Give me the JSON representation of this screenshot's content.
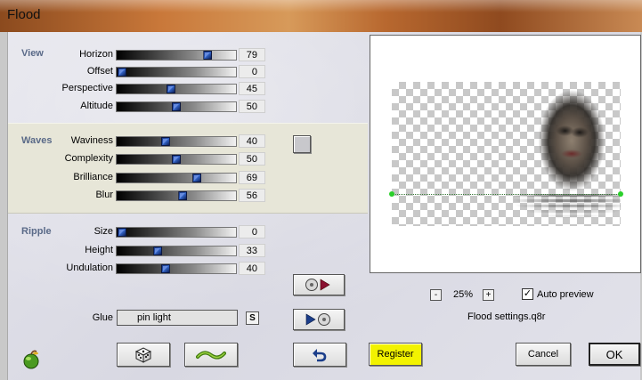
{
  "window": {
    "title": "Flood"
  },
  "groups": {
    "view": "View",
    "waves": "Waves",
    "ripple": "Ripple"
  },
  "sliders": [
    {
      "label": "Horizon",
      "value": "79",
      "level": 0.79
    },
    {
      "label": "Offset",
      "value": "0",
      "level": 0.0
    },
    {
      "label": "Perspective",
      "value": "45",
      "level": 0.45
    },
    {
      "label": "Altitude",
      "value": "50",
      "level": 0.5
    },
    {
      "label": "Waviness",
      "value": "40",
      "level": 0.4
    },
    {
      "label": "Complexity",
      "value": "50",
      "level": 0.5
    },
    {
      "label": "Brilliance",
      "value": "69",
      "level": 0.69
    },
    {
      "label": "Blur",
      "value": "56",
      "level": 0.56
    },
    {
      "label": "Size",
      "value": "0",
      "level": 0.0
    },
    {
      "label": "Height",
      "value": "33",
      "level": 0.33
    },
    {
      "label": "Undulation",
      "value": "40",
      "level": 0.4
    }
  ],
  "glue": {
    "label": "Glue",
    "value": "pin light",
    "s_button": "S"
  },
  "zoom": {
    "minus": "-",
    "value": "25%",
    "plus": "+"
  },
  "auto_preview": {
    "label": "Auto preview",
    "checked": true,
    "mark": "✓"
  },
  "settings_file": "Flood settings.q8r",
  "buttons": {
    "register": "Register",
    "cancel": "Cancel",
    "ok": "OK"
  },
  "colors": {
    "register_bg": "#f2f200",
    "group_label": "#5a6a88",
    "thumb": "#2f5fc0",
    "waves_band": "#e7e6d8"
  },
  "icons": {
    "app": "green-apple-icon",
    "random": "dice-icon",
    "reset": "wave-icon",
    "undo": "undo-arrow-icon",
    "load": "load-preset-icon",
    "save": "save-preset-icon"
  }
}
